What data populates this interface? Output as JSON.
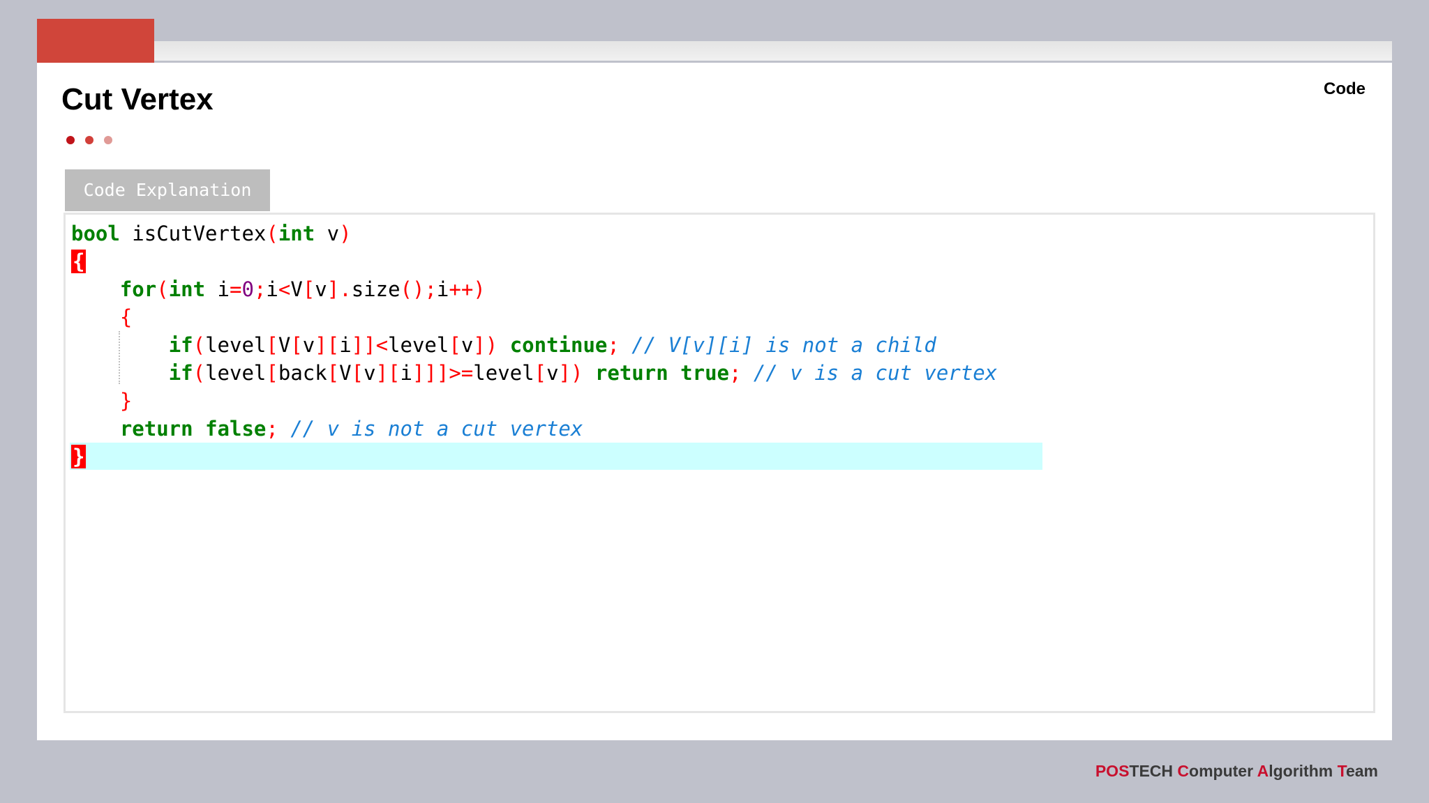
{
  "slide": {
    "title": "Cut Vertex",
    "section_label": "Code",
    "tab_label": "Code Explanation",
    "dot_colors": [
      "#c0141a",
      "#d2403a",
      "#e09a96"
    ]
  },
  "code_lines": [
    {
      "indent": 0,
      "tokens": [
        {
          "t": "bool",
          "c": "kw"
        },
        {
          "t": " isCutVertex",
          "c": "id"
        },
        {
          "t": "(",
          "c": "op"
        },
        {
          "t": "int",
          "c": "kw"
        },
        {
          "t": " v",
          "c": "id"
        },
        {
          "t": ")",
          "c": "op"
        }
      ]
    },
    {
      "indent": 0,
      "tokens": [
        {
          "t": "{",
          "c": "brace"
        }
      ]
    },
    {
      "indent": 1,
      "tokens": [
        {
          "t": "for",
          "c": "kw"
        },
        {
          "t": "(",
          "c": "op"
        },
        {
          "t": "int",
          "c": "kw"
        },
        {
          "t": " i",
          "c": "id"
        },
        {
          "t": "=",
          "c": "op"
        },
        {
          "t": "0",
          "c": "num"
        },
        {
          "t": ";",
          "c": "op"
        },
        {
          "t": "i",
          "c": "id"
        },
        {
          "t": "<",
          "c": "op"
        },
        {
          "t": "V",
          "c": "id"
        },
        {
          "t": "[",
          "c": "op"
        },
        {
          "t": "v",
          "c": "id"
        },
        {
          "t": "].",
          "c": "op"
        },
        {
          "t": "size",
          "c": "id"
        },
        {
          "t": "();",
          "c": "op"
        },
        {
          "t": "i",
          "c": "id"
        },
        {
          "t": "++)",
          "c": "op"
        }
      ]
    },
    {
      "indent": 1,
      "tokens": [
        {
          "t": "{",
          "c": "op"
        }
      ]
    },
    {
      "indent": 2,
      "tokens": [
        {
          "t": "if",
          "c": "kw"
        },
        {
          "t": "(",
          "c": "op"
        },
        {
          "t": "level",
          "c": "id"
        },
        {
          "t": "[",
          "c": "op"
        },
        {
          "t": "V",
          "c": "id"
        },
        {
          "t": "[",
          "c": "op"
        },
        {
          "t": "v",
          "c": "id"
        },
        {
          "t": "][",
          "c": "op"
        },
        {
          "t": "i",
          "c": "id"
        },
        {
          "t": "]]<",
          "c": "op"
        },
        {
          "t": "level",
          "c": "id"
        },
        {
          "t": "[",
          "c": "op"
        },
        {
          "t": "v",
          "c": "id"
        },
        {
          "t": "])",
          "c": "op"
        },
        {
          "t": " ",
          "c": "id"
        },
        {
          "t": "continue",
          "c": "kw"
        },
        {
          "t": ";",
          "c": "op"
        },
        {
          "t": " // V[v][i] is not a child",
          "c": "cm"
        }
      ]
    },
    {
      "indent": 2,
      "tokens": [
        {
          "t": "if",
          "c": "kw"
        },
        {
          "t": "(",
          "c": "op"
        },
        {
          "t": "level",
          "c": "id"
        },
        {
          "t": "[",
          "c": "op"
        },
        {
          "t": "back",
          "c": "id"
        },
        {
          "t": "[",
          "c": "op"
        },
        {
          "t": "V",
          "c": "id"
        },
        {
          "t": "[",
          "c": "op"
        },
        {
          "t": "v",
          "c": "id"
        },
        {
          "t": "][",
          "c": "op"
        },
        {
          "t": "i",
          "c": "id"
        },
        {
          "t": "]]]>=",
          "c": "op"
        },
        {
          "t": "level",
          "c": "id"
        },
        {
          "t": "[",
          "c": "op"
        },
        {
          "t": "v",
          "c": "id"
        },
        {
          "t": "])",
          "c": "op"
        },
        {
          "t": " ",
          "c": "id"
        },
        {
          "t": "return",
          "c": "kw"
        },
        {
          "t": " ",
          "c": "id"
        },
        {
          "t": "true",
          "c": "kw"
        },
        {
          "t": ";",
          "c": "op"
        },
        {
          "t": " // v is a cut vertex",
          "c": "cm"
        }
      ]
    },
    {
      "indent": 1,
      "tokens": [
        {
          "t": "}",
          "c": "op"
        }
      ]
    },
    {
      "indent": 1,
      "tokens": [
        {
          "t": "return",
          "c": "kw"
        },
        {
          "t": " ",
          "c": "id"
        },
        {
          "t": "false",
          "c": "kw"
        },
        {
          "t": ";",
          "c": "op"
        },
        {
          "t": " // v is not a cut vertex",
          "c": "cm"
        }
      ]
    },
    {
      "indent": 0,
      "tokens": [
        {
          "t": "}",
          "c": "brace"
        }
      ]
    }
  ],
  "footer": [
    {
      "t": "POS",
      "c": "r"
    },
    {
      "t": "TECH ",
      "c": "n"
    },
    {
      "t": "C",
      "c": "r"
    },
    {
      "t": "omputer ",
      "c": "n"
    },
    {
      "t": "A",
      "c": "r"
    },
    {
      "t": "lgorithm ",
      "c": "n"
    },
    {
      "t": "T",
      "c": "r"
    },
    {
      "t": "eam",
      "c": "n"
    }
  ]
}
